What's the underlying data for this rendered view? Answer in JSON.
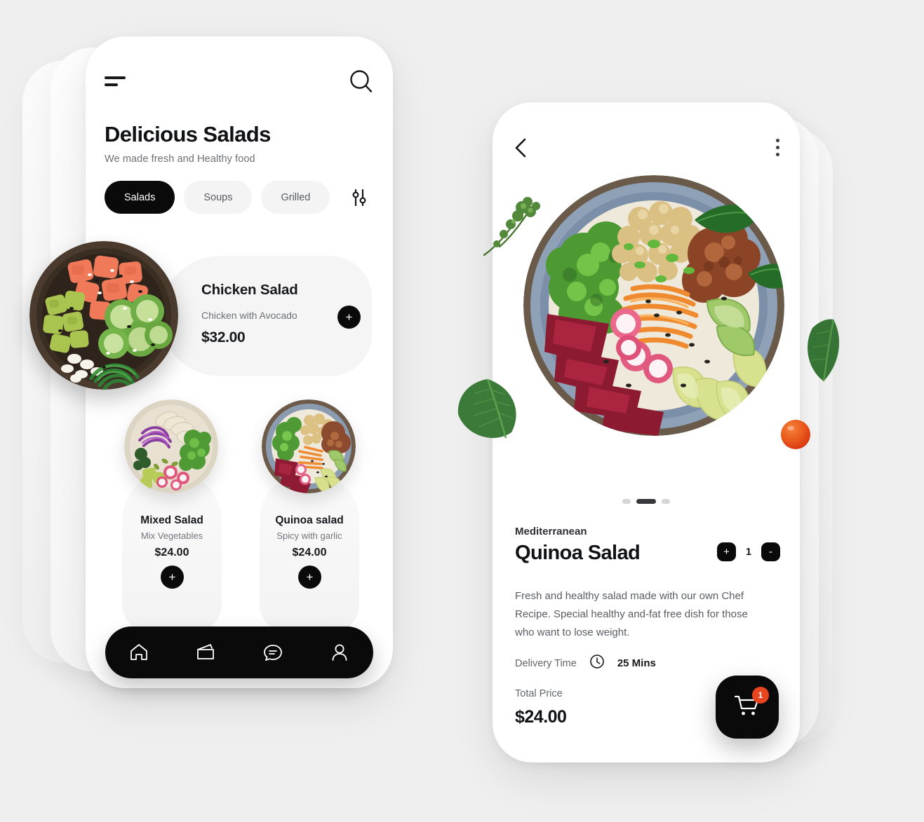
{
  "left_screen": {
    "menu_icon": "hamburger-menu-icon",
    "search_icon": "search-icon",
    "title": "Delicious Salads",
    "subtitle": "We made fresh and Healthy food",
    "filter_icon": "filter-sliders-icon",
    "categories": [
      {
        "label": "Salads",
        "active": true
      },
      {
        "label": "Soups",
        "active": false
      },
      {
        "label": "Grilled",
        "active": false
      }
    ],
    "featured": {
      "name": "Chicken Salad",
      "description": "Chicken with Avocado",
      "price": "$32.00",
      "add_label": "+",
      "image": "salmon-poke-bowl"
    },
    "items": [
      {
        "name": "Mixed Salad",
        "description": "Mix Vegetables",
        "price": "$24.00",
        "add_label": "+",
        "image": "mixed-salad-bowl"
      },
      {
        "name": "Quinoa salad",
        "description": "Spicy with garlic",
        "price": "$24.00",
        "add_label": "+",
        "image": "quinoa-salad-bowl"
      }
    ],
    "bottom_nav": [
      {
        "icon": "home-icon",
        "active": true
      },
      {
        "icon": "wallet-icon",
        "active": false
      },
      {
        "icon": "chat-icon",
        "active": false
      },
      {
        "icon": "profile-icon",
        "active": false
      }
    ]
  },
  "right_screen": {
    "back_icon": "chevron-left-icon",
    "more_icon": "more-vertical-icon",
    "hero_image": "mediterranean-buddha-bowl",
    "carousel": {
      "count": 3,
      "active_index": 1
    },
    "eyebrow": "Mediterranean",
    "title": "Quinoa Salad",
    "quantity": "1",
    "increase_label": "+",
    "decrease_label": "-",
    "description": "Fresh and healthy salad made with our own Chef Recipe. Special healthy and-fat free dish for those who want to lose weight.",
    "delivery_label": "Delivery Time",
    "delivery_icon": "clock-icon",
    "delivery_time": "25 Mins",
    "total_label": "Total Price",
    "total_price": "$24.00",
    "cart_icon": "shopping-cart-icon",
    "cart_badge": "1"
  },
  "colors": {
    "background": "#efefef",
    "card": "#ffffff",
    "accent_dark": "#0a0a0b",
    "pill_inactive": "#f4f4f5",
    "badge_orange": "#e8441f",
    "text_primary": "#16181c",
    "text_muted": "#6c7076"
  }
}
